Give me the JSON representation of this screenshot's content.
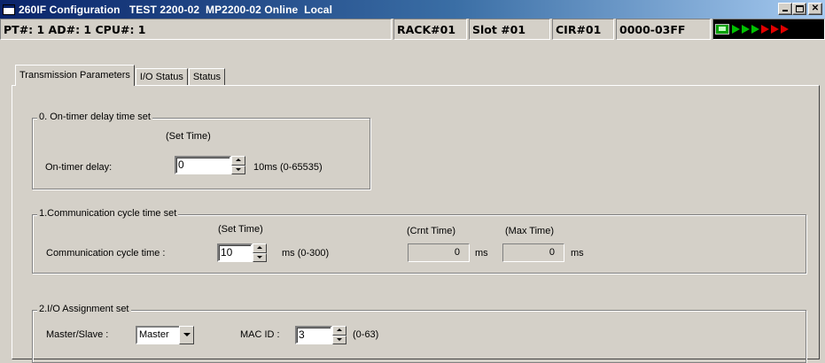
{
  "window": {
    "title": "260IF Configuration   TEST 2200-02  MP2200-02 Online  Local"
  },
  "statusbar": {
    "location": "PT#: 1 AD#:  1 CPU#: 1",
    "rack": "RACK#01",
    "slot": "Slot #01",
    "cir": "CIR#01",
    "address_range": "0000-03FF"
  },
  "tabs": [
    {
      "label": "Transmission Parameters",
      "active": true
    },
    {
      "label": "I/O Status",
      "active": false
    },
    {
      "label": "Status",
      "active": false
    }
  ],
  "on_timer": {
    "group_title": "0. On-timer delay time set",
    "set_time_header": "(Set Time)",
    "label": "On-timer delay:",
    "value": "0",
    "unit_range": "10ms (0-65535)"
  },
  "comm_cycle": {
    "group_title": "1.Communication cycle time set",
    "set_time_header": "(Set Time)",
    "crnt_time_header": "(Crnt Time)",
    "max_time_header": "(Max Time)",
    "label": "Communication cycle time :",
    "value": "10",
    "unit_range": "ms (0-300)",
    "crnt_value": "0",
    "crnt_unit": "ms",
    "max_value": "0",
    "max_unit": "ms"
  },
  "io_assignment": {
    "group_title": "2.I/O Assignment set",
    "master_slave_label": "Master/Slave :",
    "master_slave_value": "Master",
    "mac_id_label": "MAC ID :",
    "mac_id_value": "3",
    "mac_id_range": "(0-63)"
  },
  "colors": {
    "titlebar_start": "#0a246a",
    "titlebar_end": "#a6caf0",
    "face": "#d4d0c8",
    "led_green": "#00c000",
    "led_red": "#e00000"
  },
  "icons": {
    "app": "window-app-icon",
    "status": "pc-connection-icon"
  }
}
